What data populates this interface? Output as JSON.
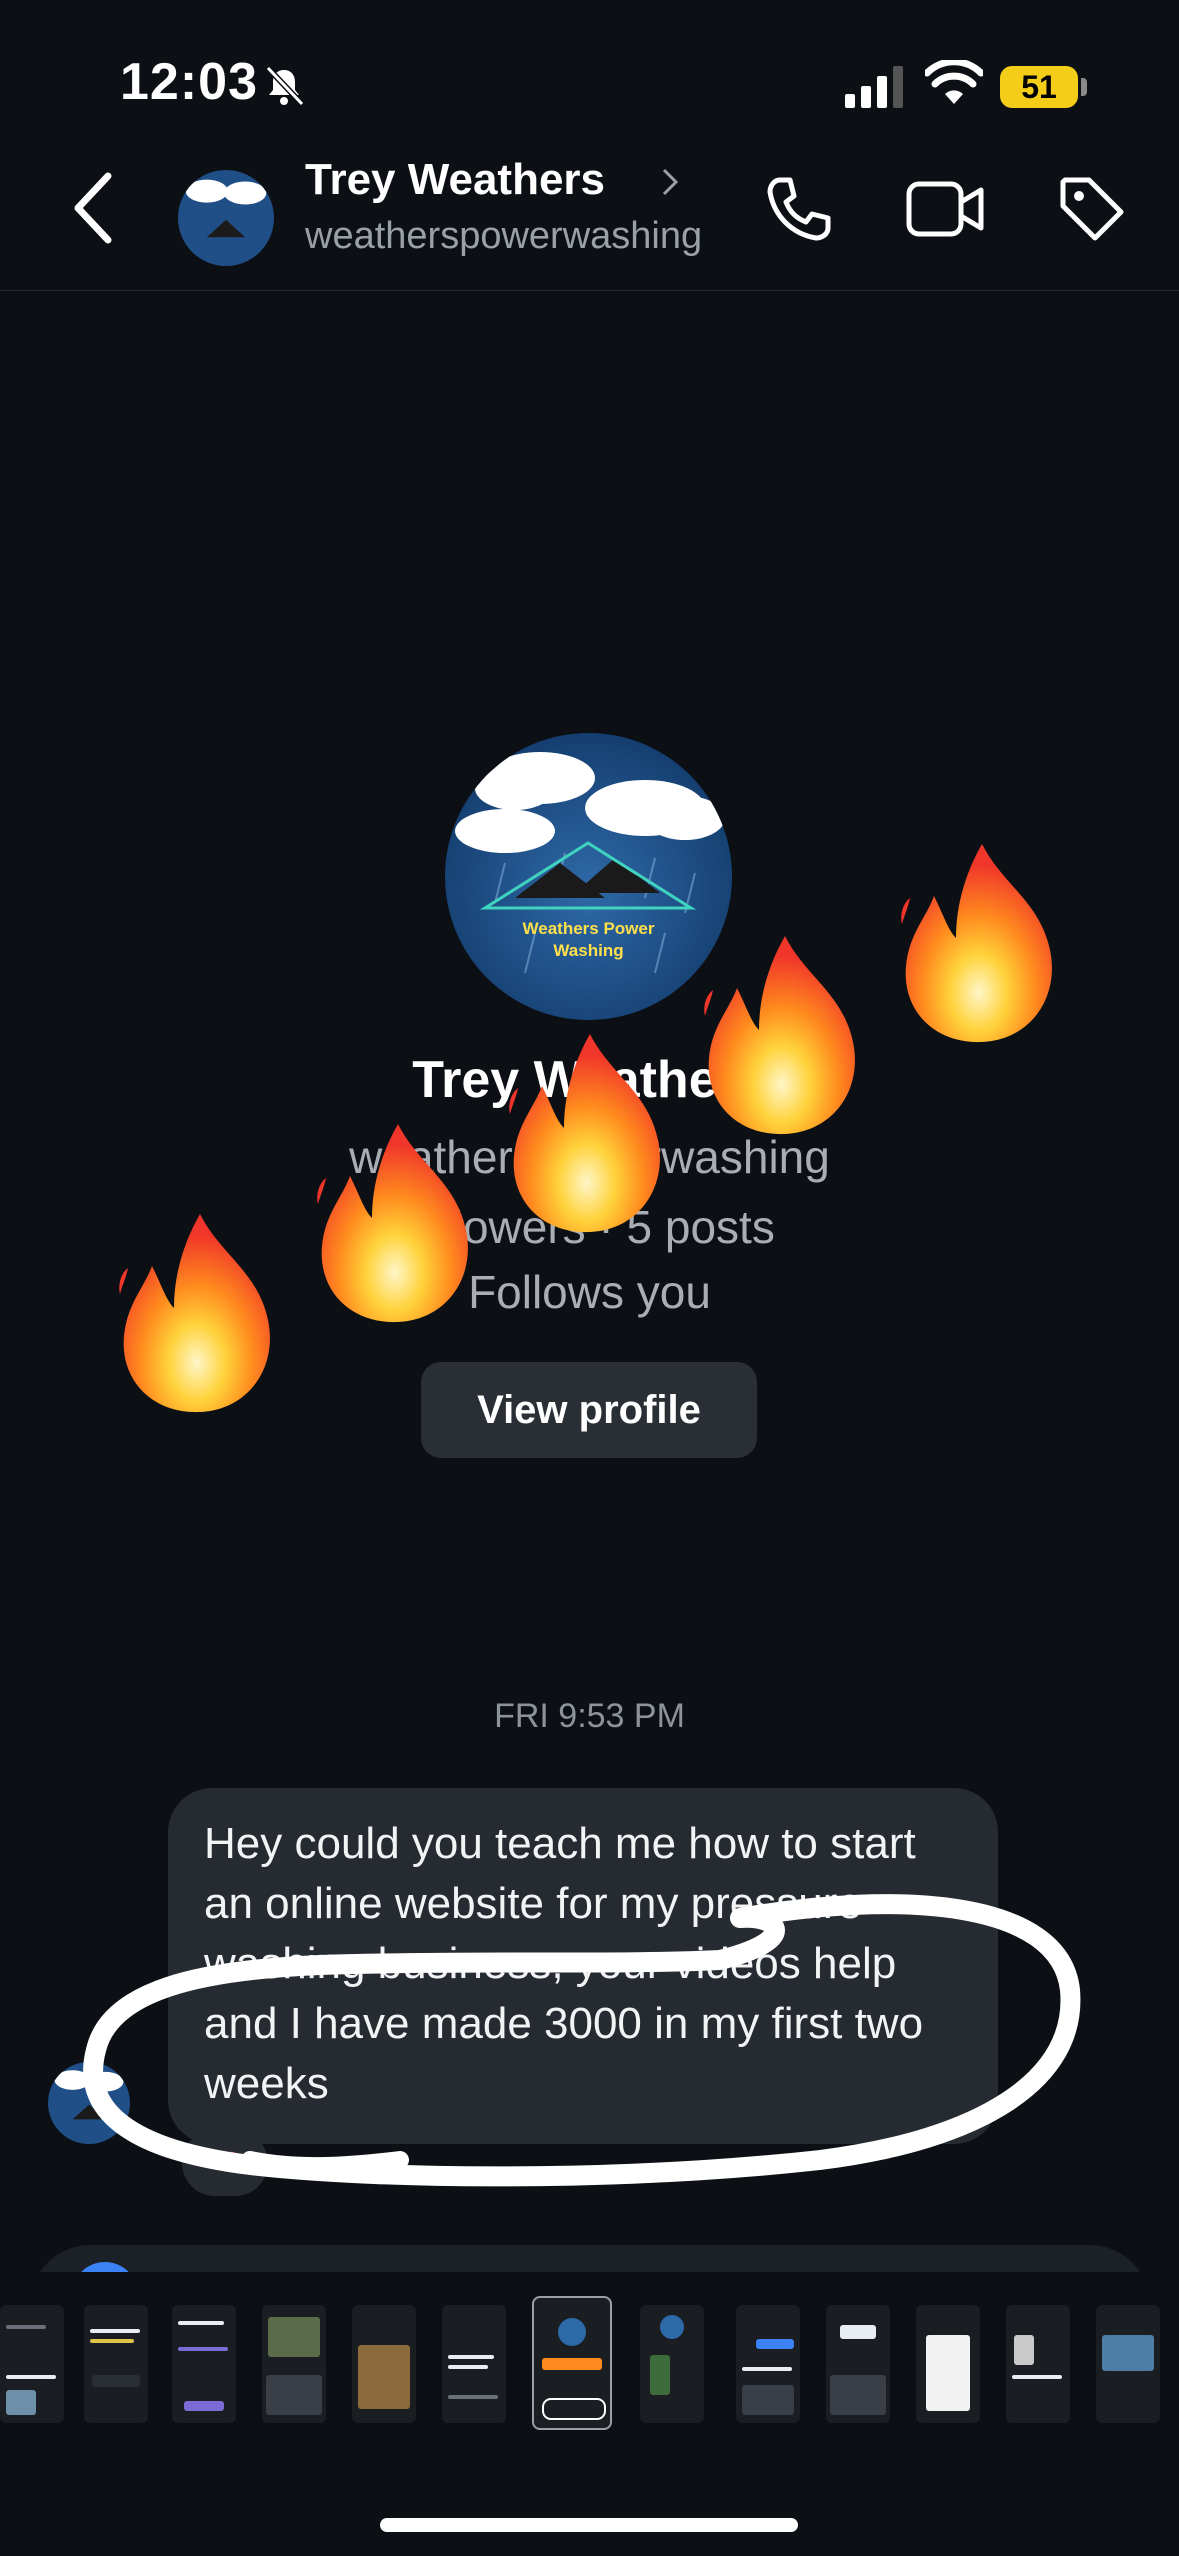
{
  "status_bar": {
    "time": "12:03",
    "battery": "51"
  },
  "header": {
    "name": "Trey Weathers",
    "username": "weatherspowerwashing"
  },
  "profile": {
    "avatar_text_line1": "Weathers Power",
    "avatar_text_line2": "Washing",
    "name": "Trey Weathers",
    "username": "weatherspowerwashing",
    "stats": "followers · 5 posts",
    "follows": "Follows you",
    "view_profile_label": "View profile"
  },
  "conversation": {
    "timestamp": "FRI 9:53 PM",
    "messages": [
      {
        "sender": "Trey Weathers",
        "text": "Hey could you teach me how to start an online website for my pressure washing business, your videos help and I have made 3000 in my first two weeks",
        "reaction": "❤"
      }
    ]
  },
  "overlay": {
    "flames": [
      "🔥",
      "🔥",
      "🔥",
      "🔥",
      "🔥"
    ]
  },
  "colors": {
    "background": "#0c0f14",
    "bubble": "#262a31",
    "accent": "#3b82f6",
    "battery": "#f3cd17"
  }
}
